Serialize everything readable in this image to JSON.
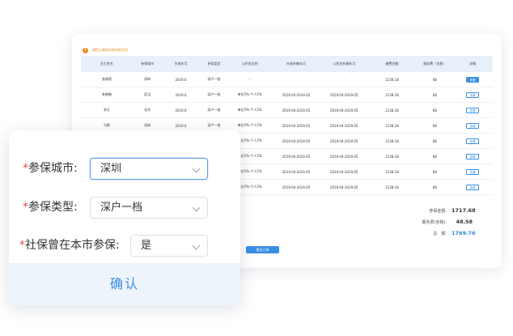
{
  "notice": {
    "text": "请您认真核对参保单信息"
  },
  "table": {
    "headers": [
      "员工姓名",
      "参保城市",
      "生效年月",
      "参保类型",
      "公积金比例",
      "社保补缴年月",
      "公积金补缴年月",
      "缴费金额",
      "服务费（含税）",
      "详情"
    ],
    "rows": [
      [
        "张斌斌",
        "深圳",
        "2019.6",
        "深户一档",
        "-",
        "-",
        "-",
        "2138.18",
        "68",
        "查看"
      ],
      [
        "李晓娟",
        "武汉",
        "2019.6",
        "深户一档",
        "单位5%-个人5%",
        "2019.04-2019.05",
        "2019.04-2019.05",
        "2138.18",
        "68",
        "查看"
      ],
      [
        "李天",
        "北京",
        "2019.6",
        "深户一档",
        "单位5%-个人5%",
        "2019.04-2019.05",
        "2019.04-2019.05",
        "2138.18",
        "68",
        "查看"
      ],
      [
        "马斯",
        "深圳",
        "2019.6",
        "深户一档",
        "单位5%-个人5%",
        "2019.04-2019.05",
        "2019.04-2019.05",
        "2138.18",
        "68",
        "查看"
      ],
      [
        "",
        "",
        "",
        "",
        "单位5%-个人5%",
        "2019.04-2019.05",
        "2019.04-2019.05",
        "2138.18",
        "68",
        "查看"
      ],
      [
        "",
        "",
        "",
        "",
        "单位5%-个人5%",
        "2019.04-2019.05",
        "2019.04-2019.05",
        "2138.18",
        "68",
        "查看"
      ],
      [
        "",
        "",
        "",
        "",
        "单位5%-个人5%",
        "2019.04-2019.05",
        "2019.04-2019.05",
        "2138.18",
        "68",
        "查看"
      ],
      [
        "",
        "",
        "",
        "",
        "单位5%-个人5%",
        "2019.04-2019.05",
        "2019.04-2019.05",
        "2138.18",
        "68",
        "查看"
      ]
    ]
  },
  "summary": {
    "insured_label": "参保金额:",
    "insured_value": "1717.68",
    "service_label": "服务费(含税):",
    "service_value": "48.58",
    "total_label": "总　额:",
    "total_value": "1769.76"
  },
  "submit_label": "提交订单",
  "form": {
    "city_label": "参保城市:",
    "city_value": "深圳",
    "type_label": "参保类型:",
    "type_value": "深户一档",
    "local_label": "社保曾在本市参保:",
    "local_value": "是",
    "required_mark": "*",
    "confirm_label": "确认"
  },
  "colors": {
    "accent": "#3a8ee6",
    "warning": "#f08a24",
    "required": "#e5484d"
  }
}
